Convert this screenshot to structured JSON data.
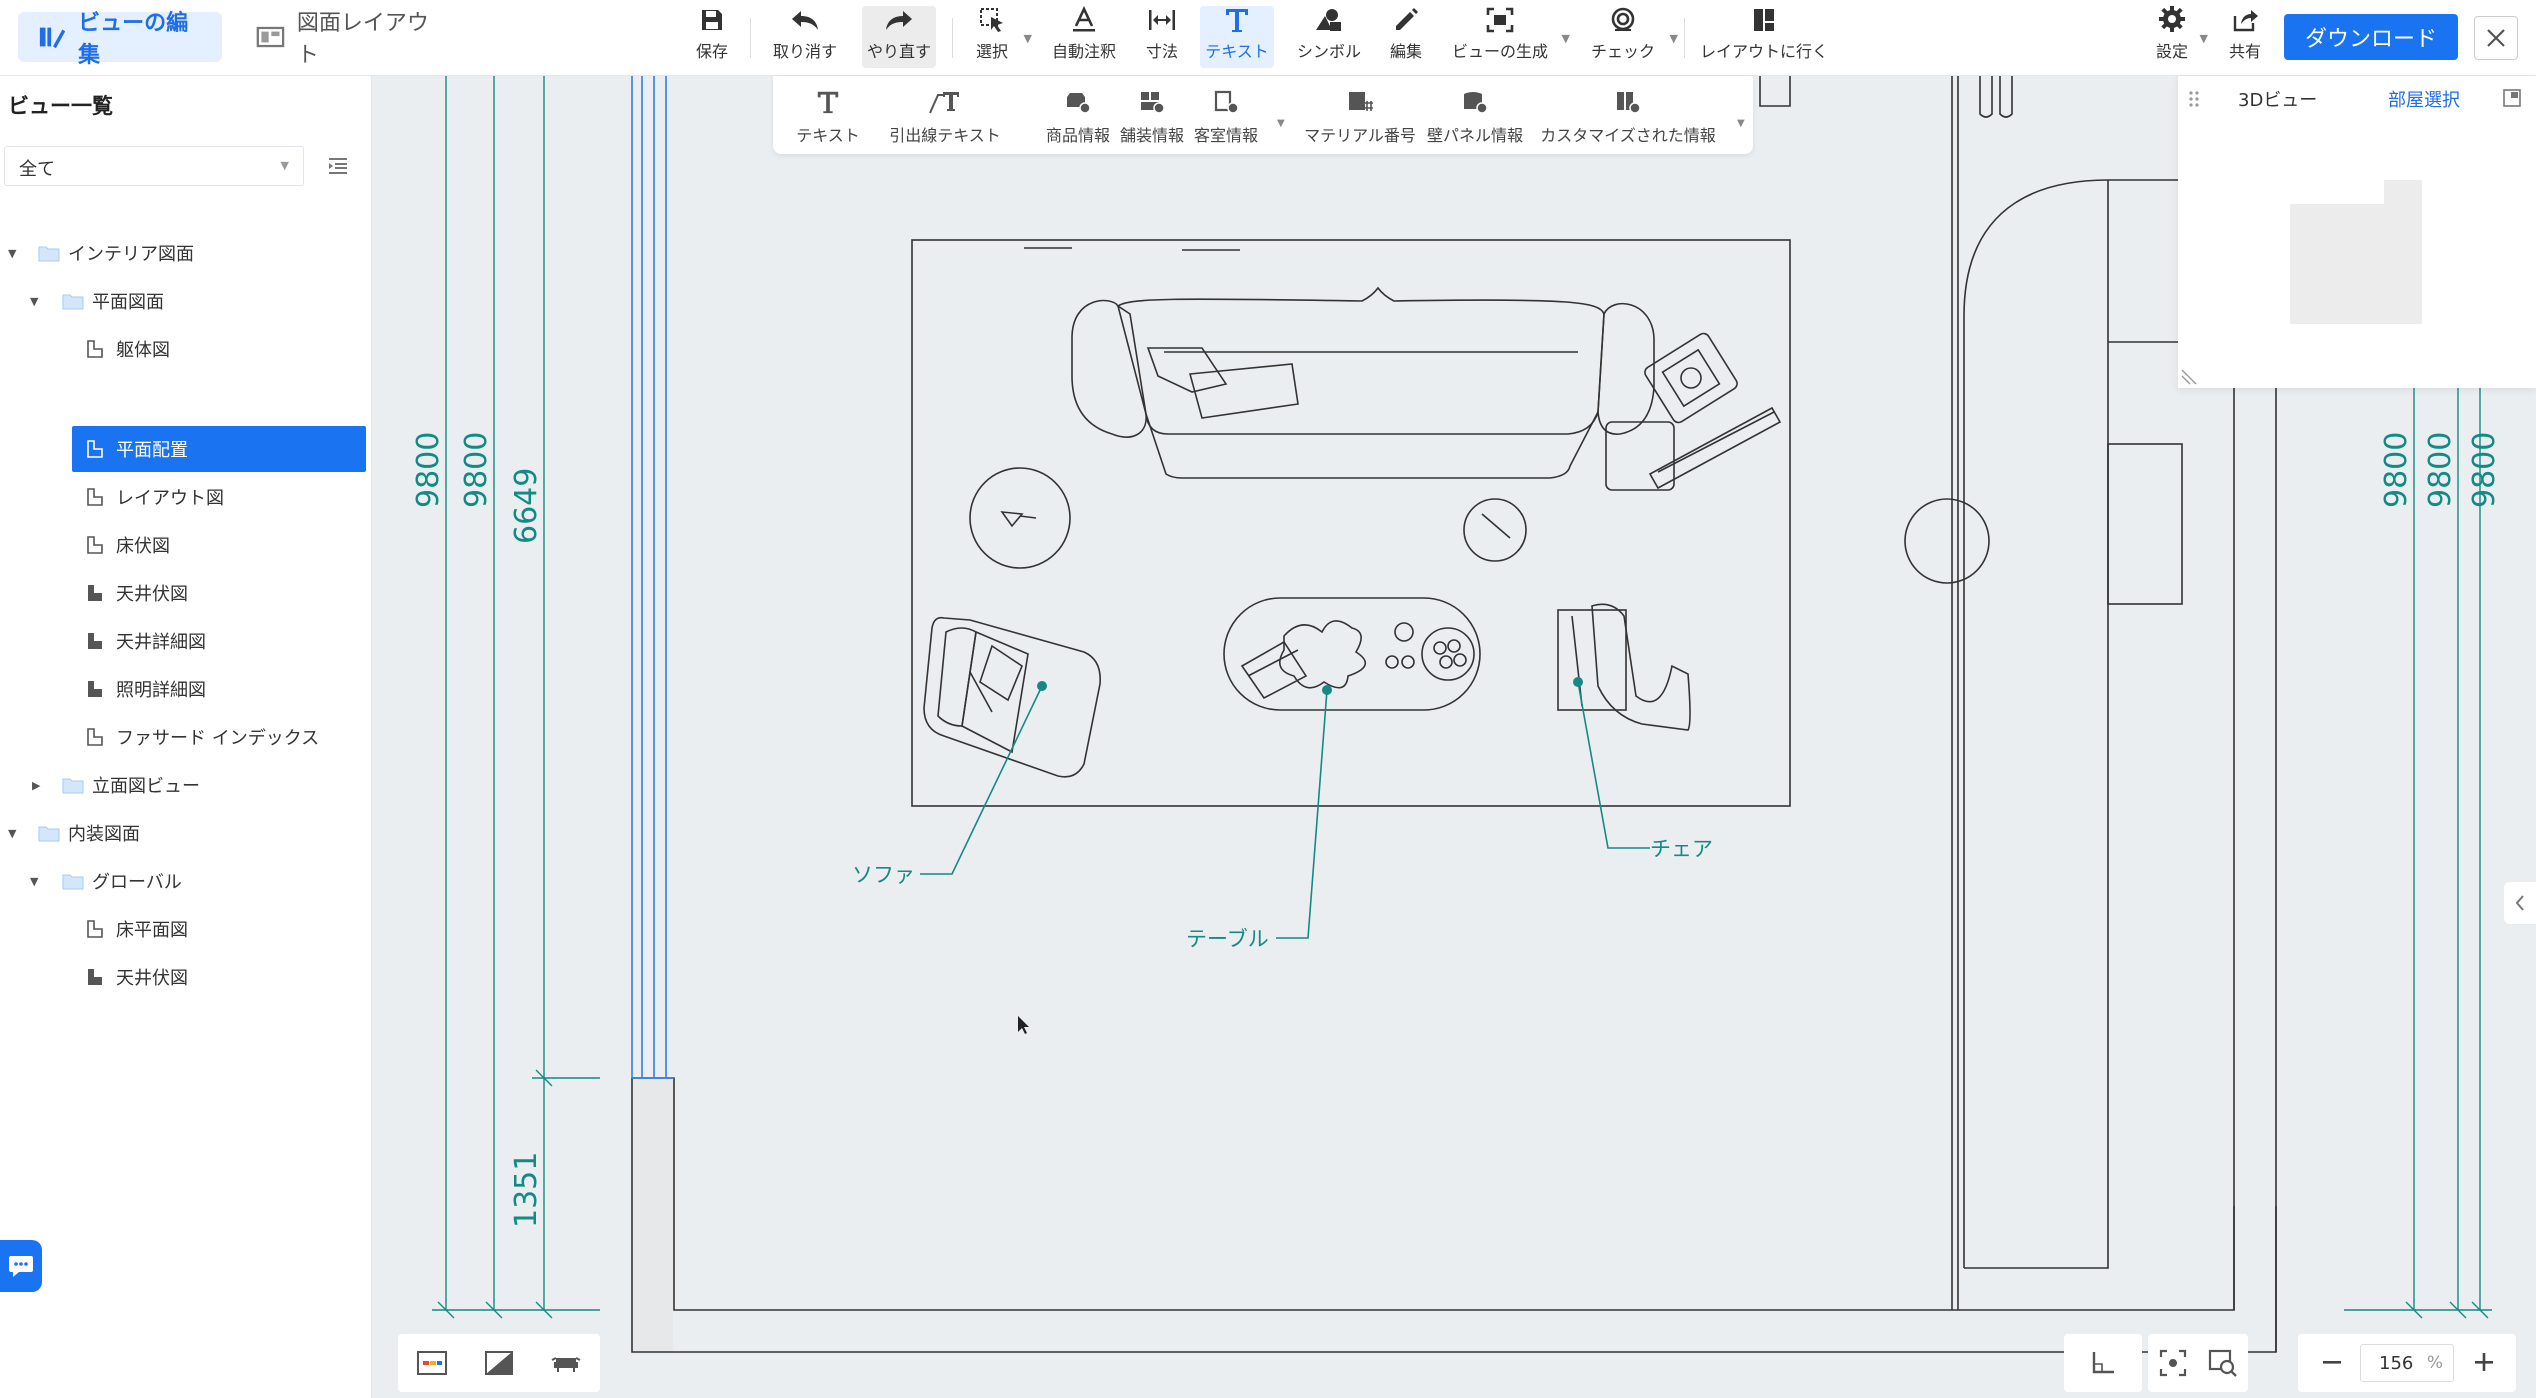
{
  "header": {
    "mode_tabs": [
      {
        "label": "ビューの編集",
        "active": true
      },
      {
        "label": "図面レイアウト",
        "active": false
      }
    ],
    "tools": {
      "save": "保存",
      "undo": "取り消す",
      "redo": "やり直す",
      "select": "選択",
      "auto_annotate": "自動注釈",
      "dimension": "寸法",
      "text": "テキスト",
      "symbol": "シンボル",
      "edit": "編集",
      "generate_view": "ビューの生成",
      "check": "チェック",
      "go_layout": "レイアウトに行く",
      "settings": "設定",
      "share": "共有"
    },
    "download": "ダウンロード"
  },
  "subtoolbar": {
    "text": "テキスト",
    "leader_text": "引出線テキスト",
    "product_info": "商品情報",
    "finish_info": "舗装情報",
    "room_info": "客室情報",
    "material_no": "マテリアル番号",
    "wall_panel_info": "壁パネル情報",
    "custom_info": "カスタマイズされた情報"
  },
  "sidebar": {
    "title": "ビュー一覧",
    "filter_value": "全て",
    "tree": [
      {
        "label": "インテリア図面",
        "type": "folder",
        "level": 0,
        "expanded": true
      },
      {
        "label": "平面図面",
        "type": "folder",
        "level": 1,
        "expanded": true
      },
      {
        "label": "躯体図",
        "type": "view",
        "level": 2
      },
      {
        "label": "平面配置",
        "type": "view",
        "level": 2,
        "selected": true
      },
      {
        "label": "レイアウト図",
        "type": "view",
        "level": 2
      },
      {
        "label": "床伏図",
        "type": "view",
        "level": 2
      },
      {
        "label": "天井伏図",
        "type": "view",
        "level": 2
      },
      {
        "label": "天井詳細図",
        "type": "view",
        "level": 2
      },
      {
        "label": "照明詳細図",
        "type": "view",
        "level": 2
      },
      {
        "label": "ファサード インデックス",
        "type": "view",
        "level": 2
      },
      {
        "label": "立面図ビュー",
        "type": "folder",
        "level": 1,
        "expanded": false
      },
      {
        "label": "内装図面",
        "type": "folder",
        "level": 0,
        "expanded": true
      },
      {
        "label": "グローバル",
        "type": "folder",
        "level": 1,
        "expanded": true
      },
      {
        "label": "床平面図",
        "type": "view",
        "level": 2
      },
      {
        "label": "天井伏図",
        "type": "view",
        "level": 2
      }
    ]
  },
  "panel3d": {
    "tab_3d": "3Dビュー",
    "tab_room": "部屋選択"
  },
  "drawing": {
    "dims_left": [
      "9800",
      "9800",
      "6649",
      "1351"
    ],
    "dims_right": [
      "9800",
      "9800",
      "9800"
    ],
    "labels": {
      "sofa": "ソファ",
      "table": "テーブル",
      "chair": "チェア"
    },
    "colors": {
      "annotation": "#138a84",
      "wall_line": "#333333",
      "guide_line": "#2f7fe8"
    }
  },
  "zoom": {
    "value": "156",
    "unit": "%"
  }
}
